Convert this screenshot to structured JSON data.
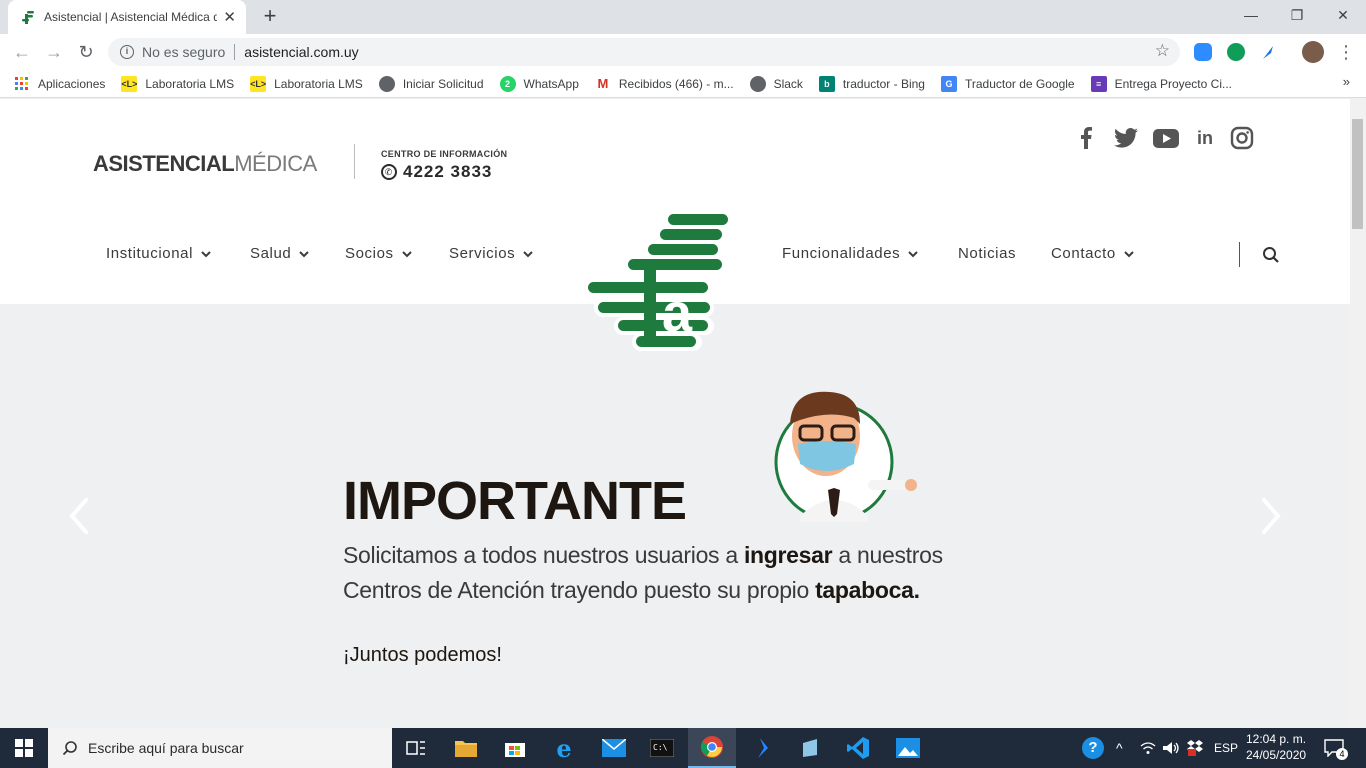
{
  "browser": {
    "tab_title": "Asistencial | Asistencial Médica d",
    "security_label": "No es seguro",
    "url": "asistencial.com.uy",
    "bookmarks": [
      {
        "label": "Aplicaciones",
        "icon": "apps-grid-icon"
      },
      {
        "label": "Laboratoria LMS",
        "icon": "laboratoria-icon",
        "badge": "<L>"
      },
      {
        "label": "Laboratoria LMS",
        "icon": "laboratoria-icon",
        "badge": "<L>"
      },
      {
        "label": "Iniciar Solicitud",
        "icon": "globe-icon"
      },
      {
        "label": "WhatsApp",
        "icon": "whatsapp-icon"
      },
      {
        "label": "Recibidos (466) - m...",
        "icon": "gmail-icon"
      },
      {
        "label": "Slack",
        "icon": "globe-icon"
      },
      {
        "label": "traductor - Bing",
        "icon": "bing-icon"
      },
      {
        "label": "Traductor de Google",
        "icon": "google-translate-icon"
      },
      {
        "label": "Entrega Proyecto Ci...",
        "icon": "forms-icon"
      }
    ]
  },
  "site": {
    "logo_bold": "ASISTENCIAL",
    "logo_light": "MÉDICA",
    "centro_label": "CENTRO DE INFORMACIÓN",
    "centro_phone": "4222 3833",
    "social": [
      "facebook-icon",
      "twitter-icon",
      "youtube-icon",
      "linkedin-icon",
      "instagram-icon"
    ],
    "nav": {
      "institucional": "Institucional",
      "salud": "Salud",
      "socios": "Socios",
      "servicios": "Servicios",
      "funcionalidades": "Funcionalidades",
      "noticias": "Noticias",
      "contacto": "Contacto"
    },
    "brand_color": "#1f7a3e"
  },
  "slide": {
    "headline": "IMPORTANTE",
    "line1_pre": "Solicitamos a todos nuestros usuarios a ",
    "line1_bold": "ingresar",
    "line1_post": " a nuestros",
    "line2_pre": "Centros de Atención trayendo puesto su propio ",
    "line2_bold": "tapaboca.",
    "closing": "¡Juntos podemos!"
  },
  "taskbar": {
    "search_placeholder": "Escribe aquí para buscar",
    "language": "ESP",
    "time": "12:04 p. m.",
    "date": "24/05/2020",
    "notifications": "4"
  }
}
